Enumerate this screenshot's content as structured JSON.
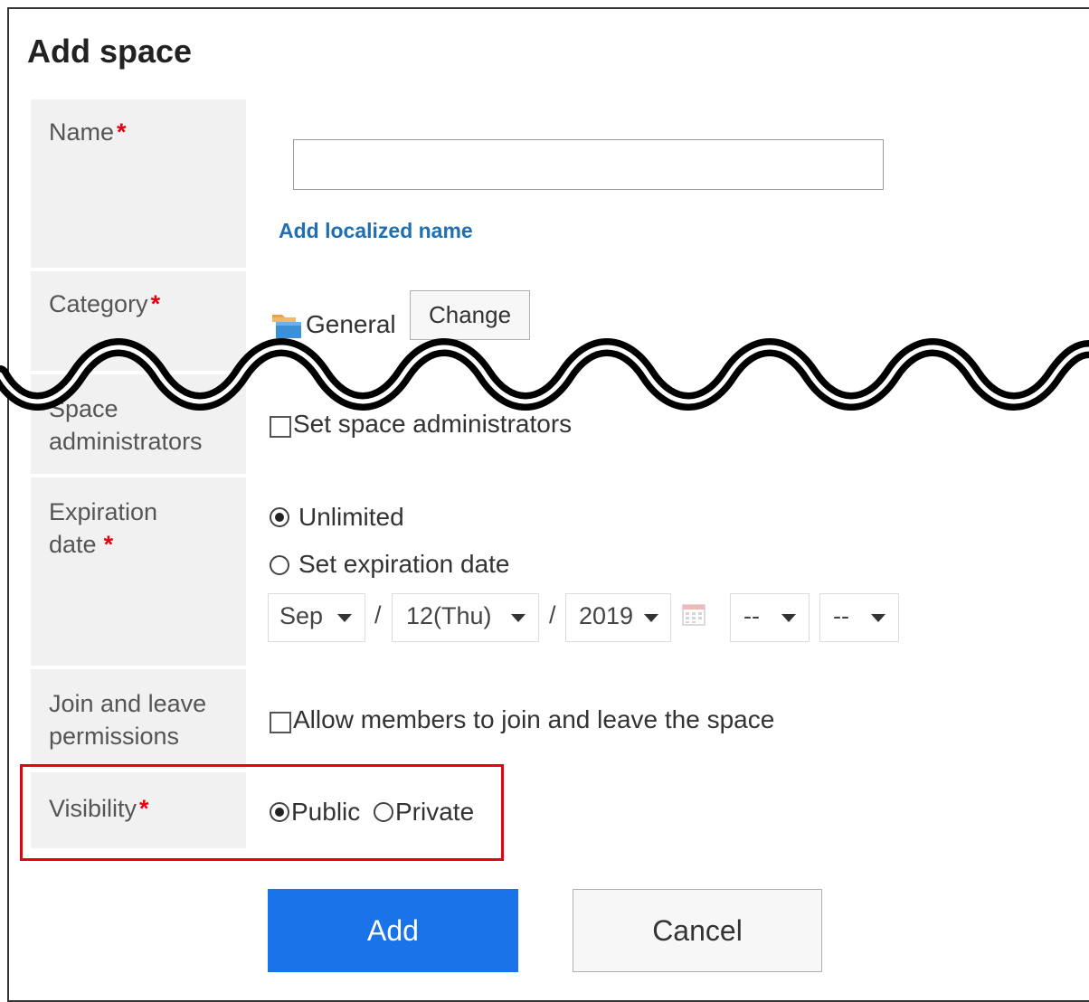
{
  "dialog": {
    "title": "Add space"
  },
  "form": {
    "name": {
      "label": "Name",
      "required": "*",
      "value": "",
      "localized_link": "Add localized name"
    },
    "category": {
      "label": "Category",
      "required": "*",
      "value": "General",
      "change_button": "Change"
    },
    "space_admins": {
      "label_partial": "Space",
      "label_line2": "administrators",
      "checkbox_label": "Set space administrators",
      "checked": false
    },
    "expiration": {
      "label_line1": "Expiration",
      "label_line2": "date",
      "required": "*",
      "option_unlimited": "Unlimited",
      "option_set": "Set expiration date",
      "selected": "Unlimited",
      "month": "Sep",
      "day": "12(Thu)",
      "year": "2019",
      "hour": "--",
      "minute": "--",
      "separator": "/"
    },
    "join_leave": {
      "label_line1": "Join and leave",
      "label_line2": "permissions",
      "checkbox_label": "Allow members to join and leave the space",
      "checked": false
    },
    "visibility": {
      "label": "Visibility",
      "required": "*",
      "option_public": "Public",
      "option_private": "Private",
      "selected": "Public"
    }
  },
  "actions": {
    "add": "Add",
    "cancel": "Cancel"
  },
  "colors": {
    "primary": "#1a73e8",
    "required": "#e60012",
    "highlight": "#e60012",
    "link": "#1f6fb2",
    "label_bg": "#f1f1f1"
  },
  "icons": {
    "category": "folder-icon",
    "calendar": "calendar-icon"
  }
}
